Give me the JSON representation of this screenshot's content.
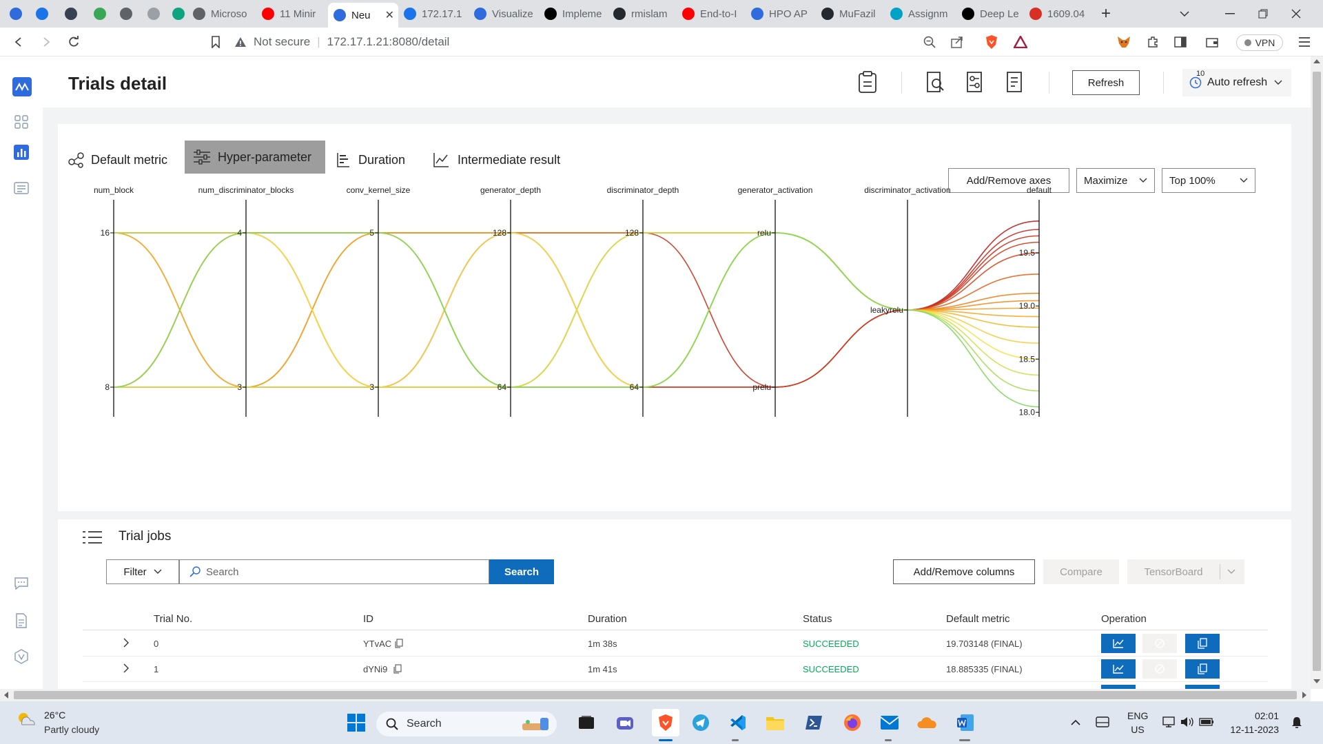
{
  "browser": {
    "tabs": [
      {
        "label": "Microso",
        "color": "#5f6368"
      },
      {
        "label": "11 Minir",
        "color": "#ff0000"
      },
      {
        "label": "Neu",
        "color": "#2f6bdc"
      },
      {
        "label": "172.17.1",
        "color": "#1a73e8"
      },
      {
        "label": "Visualize",
        "color": "#2f6bdc"
      },
      {
        "label": "Impleme",
        "color": "#000000"
      },
      {
        "label": "rmislam",
        "color": "#24292f"
      },
      {
        "label": "End-to-I",
        "color": "#ff0000"
      },
      {
        "label": "HPO AP",
        "color": "#2f6bdc"
      },
      {
        "label": "MuFazil",
        "color": "#24292f"
      },
      {
        "label": "Assignm",
        "color": "#00a2c7"
      },
      {
        "label": "Deep Le",
        "color": "#000000"
      },
      {
        "label": "1609.04",
        "color": "#d93025"
      }
    ],
    "new_tab": "+",
    "security_label": "Not secure",
    "url": "172.17.1.21:8080/detail",
    "vpn_label": "VPN"
  },
  "app": {
    "page_title": "Trials detail",
    "refresh_label": "Refresh",
    "auto_refresh_label": "Auto refresh",
    "auto_refresh_badge": "10",
    "tabs": [
      "Default metric",
      "Hyper-parameter",
      "Duration",
      "Intermediate result"
    ],
    "active_tab": "Hyper-parameter",
    "add_remove_axes": "Add/Remove axes",
    "maximize": "Maximize",
    "top_percent": "Top 100%"
  },
  "chart_data": {
    "type": "parallel-coordinates",
    "axes": [
      "num_block",
      "num_discriminator_blocks",
      "conv_kernel_size",
      "generator_depth",
      "discriminator_depth",
      "generator_activation",
      "discriminator_activation",
      "default"
    ],
    "axis_ticks": {
      "num_block": [
        "16",
        "8"
      ],
      "num_discriminator_blocks": [
        "4",
        "3"
      ],
      "conv_kernel_size": [
        "5",
        "3"
      ],
      "generator_depth": [
        "128",
        "64"
      ],
      "discriminator_depth": [
        "128",
        "64"
      ],
      "generator_activation": [
        "relu",
        "prelu"
      ],
      "discriminator_activation": [
        "leakyrelu"
      ],
      "default": [
        "19.5",
        "19.0",
        "18.5",
        "18.0"
      ]
    },
    "default_range": [
      17.97,
      19.87
    ],
    "color_scale": [
      "#7ed957",
      "#f6e34a",
      "#f5a623",
      "#e05a1a",
      "#c0201e"
    ],
    "trials": [
      {
        "num_block": 16,
        "num_discriminator_blocks": 4,
        "conv_kernel_size": 5,
        "generator_depth": 128,
        "discriminator_depth": 128,
        "generator_activation": "relu",
        "discriminator_activation": "leakyrelu",
        "default": 19.72
      },
      {
        "num_block": 8,
        "num_discriminator_blocks": 4,
        "conv_kernel_size": 5,
        "generator_depth": 128,
        "discriminator_depth": 64,
        "generator_activation": "prelu",
        "discriminator_activation": "leakyrelu",
        "default": 19.8
      },
      {
        "num_block": 16,
        "num_discriminator_blocks": 3,
        "conv_kernel_size": 3,
        "generator_depth": 128,
        "discriminator_depth": 128,
        "generator_activation": "prelu",
        "discriminator_activation": "leakyrelu",
        "default": 19.66
      },
      {
        "num_block": 8,
        "num_discriminator_blocks": 4,
        "conv_kernel_size": 3,
        "generator_depth": 128,
        "discriminator_depth": 64,
        "generator_activation": "prelu",
        "discriminator_activation": "leakyrelu",
        "default": 19.6
      },
      {
        "num_block": 16,
        "num_discriminator_blocks": 4,
        "conv_kernel_size": 5,
        "generator_depth": 64,
        "discriminator_depth": 128,
        "generator_activation": "relu",
        "discriminator_activation": "leakyrelu",
        "default": 19.5
      },
      {
        "num_block": 8,
        "num_discriminator_blocks": 3,
        "conv_kernel_size": 5,
        "generator_depth": 64,
        "discriminator_depth": 64,
        "generator_activation": "relu",
        "discriminator_activation": "leakyrelu",
        "default": 19.3
      },
      {
        "num_block": 16,
        "num_discriminator_blocks": 3,
        "conv_kernel_size": 5,
        "generator_depth": 128,
        "discriminator_depth": 128,
        "generator_activation": "relu",
        "discriminator_activation": "leakyrelu",
        "default": 19.12
      },
      {
        "num_block": 8,
        "num_discriminator_blocks": 4,
        "conv_kernel_size": 3,
        "generator_depth": 64,
        "discriminator_depth": 64,
        "generator_activation": "relu",
        "discriminator_activation": "leakyrelu",
        "default": 19.05
      },
      {
        "num_block": 16,
        "num_discriminator_blocks": 4,
        "conv_kernel_size": 3,
        "generator_depth": 64,
        "discriminator_depth": 128,
        "generator_activation": "relu",
        "discriminator_activation": "leakyrelu",
        "default": 18.98
      },
      {
        "num_block": 8,
        "num_discriminator_blocks": 3,
        "conv_kernel_size": 5,
        "generator_depth": 128,
        "discriminator_depth": 64,
        "generator_activation": "relu",
        "discriminator_activation": "leakyrelu",
        "default": 18.9
      },
      {
        "num_block": 16,
        "num_discriminator_blocks": 3,
        "conv_kernel_size": 3,
        "generator_depth": 64,
        "discriminator_depth": 64,
        "generator_activation": "relu",
        "discriminator_activation": "leakyrelu",
        "default": 18.8
      },
      {
        "num_block": 8,
        "num_discriminator_blocks": 4,
        "conv_kernel_size": 5,
        "generator_depth": 64,
        "discriminator_depth": 128,
        "generator_activation": "relu",
        "discriminator_activation": "leakyrelu",
        "default": 18.65
      },
      {
        "num_block": 16,
        "num_discriminator_blocks": 4,
        "conv_kernel_size": 3,
        "generator_depth": 128,
        "discriminator_depth": 64,
        "generator_activation": "relu",
        "discriminator_activation": "leakyrelu",
        "default": 18.5
      },
      {
        "num_block": 8,
        "num_discriminator_blocks": 3,
        "conv_kernel_size": 3,
        "generator_depth": 64,
        "discriminator_depth": 128,
        "generator_activation": "relu",
        "discriminator_activation": "leakyrelu",
        "default": 18.35
      },
      {
        "num_block": 16,
        "num_discriminator_blocks": 4,
        "conv_kernel_size": 5,
        "generator_depth": 64,
        "discriminator_depth": 64,
        "generator_activation": "relu",
        "discriminator_activation": "leakyrelu",
        "default": 18.2
      },
      {
        "num_block": 8,
        "num_discriminator_blocks": 4,
        "conv_kernel_size": 5,
        "generator_depth": 64,
        "discriminator_depth": 64,
        "generator_activation": "relu",
        "discriminator_activation": "leakyrelu",
        "default": 18.05
      }
    ]
  },
  "trial_jobs": {
    "title": "Trial jobs",
    "filter_label": "Filter",
    "search_placeholder": "Search",
    "search_button": "Search",
    "add_remove_columns": "Add/Remove columns",
    "compare": "Compare",
    "tensorboard": "TensorBoard",
    "columns": [
      "Trial No.",
      "ID",
      "Duration",
      "Status",
      "Default metric",
      "Operation"
    ],
    "rows": [
      {
        "trial_no": "0",
        "id": "YTvAC",
        "duration": "1m 38s",
        "status": "SUCCEEDED",
        "metric": "19.703148 (FINAL)"
      },
      {
        "trial_no": "1",
        "id": "dYNi9",
        "duration": "1m 41s",
        "status": "SUCCEEDED",
        "metric": "18.885335 (FINAL)"
      }
    ]
  },
  "taskbar": {
    "weather_temp": "26°C",
    "weather_desc": "Partly cloudy",
    "search_label": "Search",
    "lang_top": "ENG",
    "lang_bottom": "US",
    "time": "02:01",
    "date": "12-11-2023"
  }
}
